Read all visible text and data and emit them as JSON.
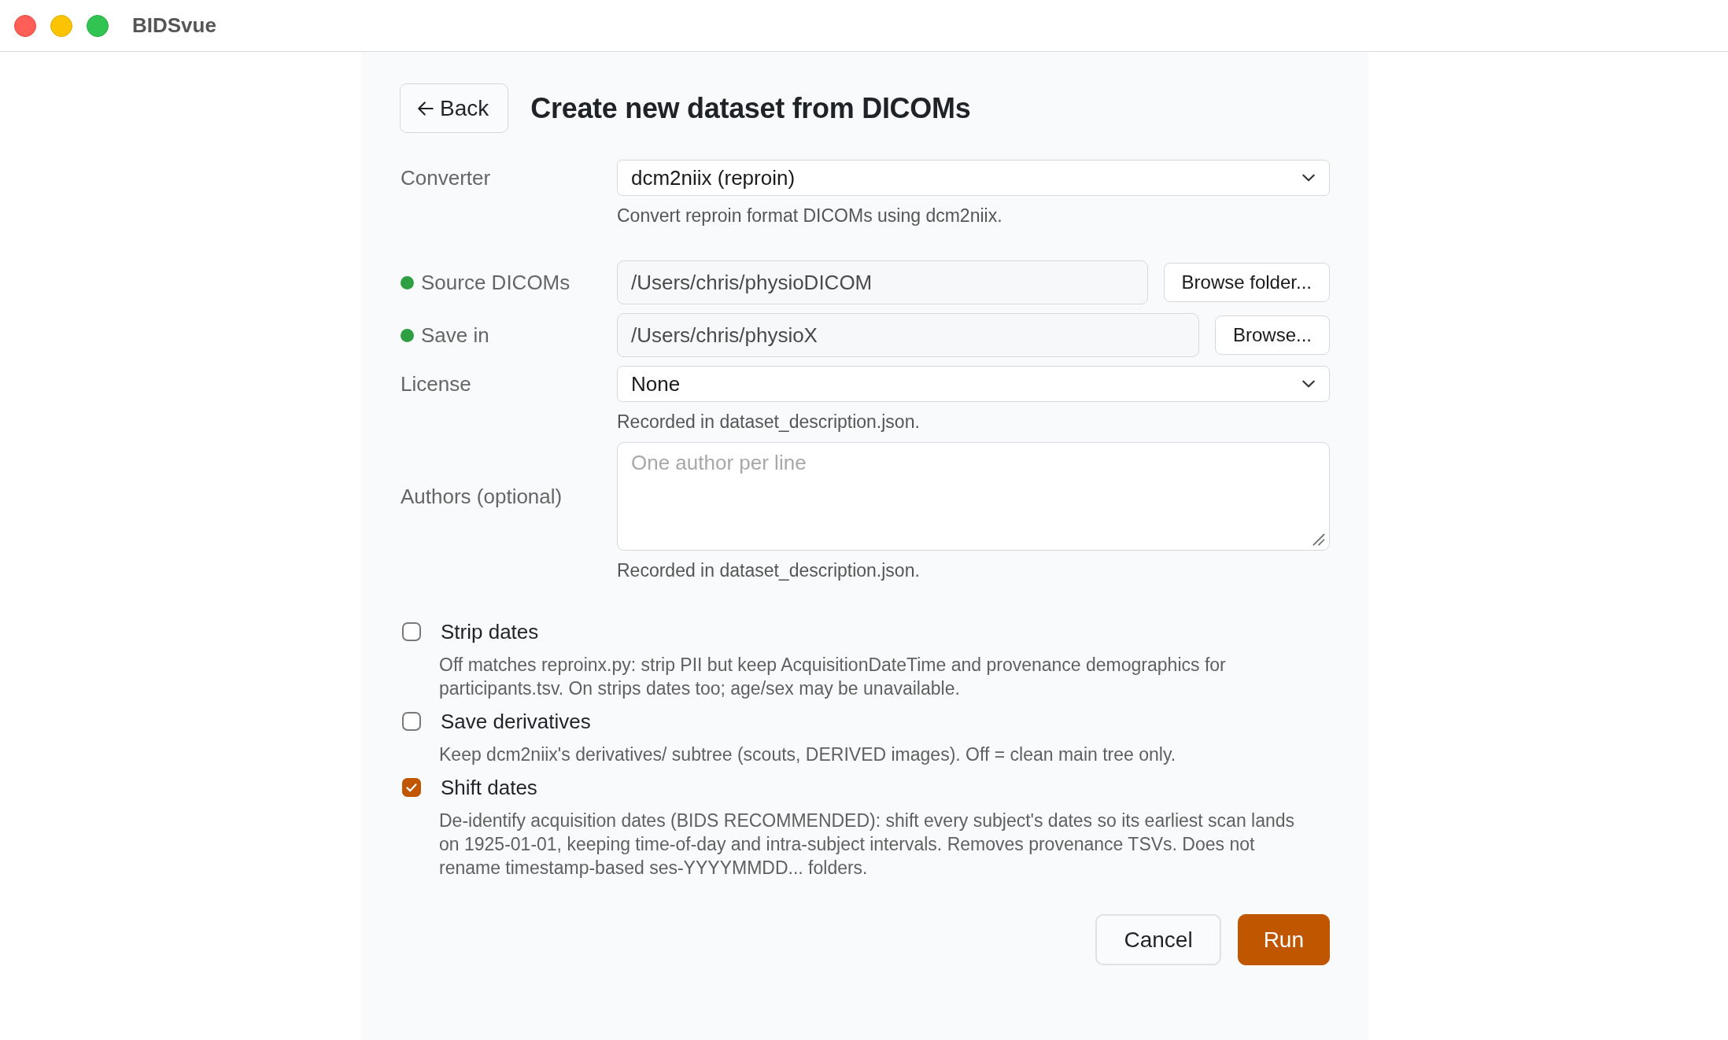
{
  "window": {
    "title": "BIDSvue"
  },
  "back_button": {
    "label": "Back"
  },
  "heading": "Create new dataset from DICOMs",
  "form": {
    "rows": [
      {
        "kind": "select",
        "label": "Converter",
        "value": "dcm2niix (reproin)",
        "hint": "Convert reproin format DICOMs using dcm2niix."
      },
      {
        "kind": "path",
        "label": "Source DICOMs",
        "color": "#2ea043",
        "value": "/Users/chris/physioDICOM",
        "button": "Browse folder..."
      },
      {
        "kind": "path",
        "label": "Save in",
        "color": "#2ea043",
        "value": "/Users/chris/physioX",
        "button": "Browse..."
      },
      {
        "kind": "select",
        "label": "License",
        "value": "None",
        "hint": "Recorded in dataset_description.json."
      },
      {
        "kind": "textarea",
        "label": "Authors (optional)",
        "placeholder": "One author per line",
        "hint": "Recorded in dataset_description.json."
      }
    ]
  },
  "options": [
    {
      "label": "Strip dates",
      "checked": false,
      "description": "Off matches reproinx.py: strip PII but keep AcquisitionDateTime and provenance demographics for participants.tsv. On strips dates too; age/sex may be unavailable."
    },
    {
      "label": "Save derivatives",
      "checked": false,
      "description": "Keep dcm2niix's derivatives/ subtree (scouts, DERIVED images). Off = clean main tree only."
    },
    {
      "label": "Shift dates",
      "checked": true,
      "description": "De-identify acquisition dates (BIDS RECOMMENDED): shift every subject's dates so its earliest scan lands on 1925-01-01, keeping time-of-day and intra-subject intervals. Removes provenance TSVs. Does not rename timestamp-based ses-YYYYMMDD... folders."
    }
  ],
  "buttons": [
    {
      "label": "Cancel",
      "kind": "secondary"
    },
    {
      "label": "Run",
      "kind": "primary"
    }
  ]
}
